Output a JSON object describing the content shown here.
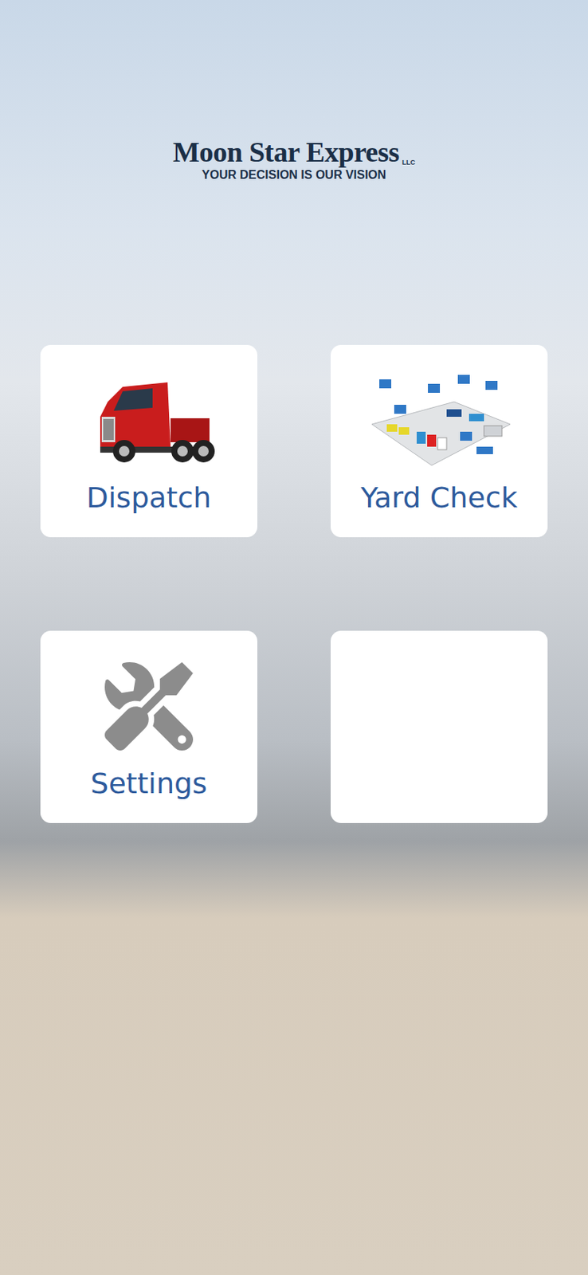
{
  "logo": {
    "name": "Moon Star Express",
    "suffix": "LLC",
    "tagline": "YOUR DECISION IS OUR VISION"
  },
  "tiles": [
    {
      "label": "Dispatch",
      "kind": "truck"
    },
    {
      "label": "Yard Check",
      "kind": "yard"
    },
    {
      "label": "Settings",
      "kind": "tools"
    },
    {
      "label": "",
      "kind": "empty"
    }
  ]
}
